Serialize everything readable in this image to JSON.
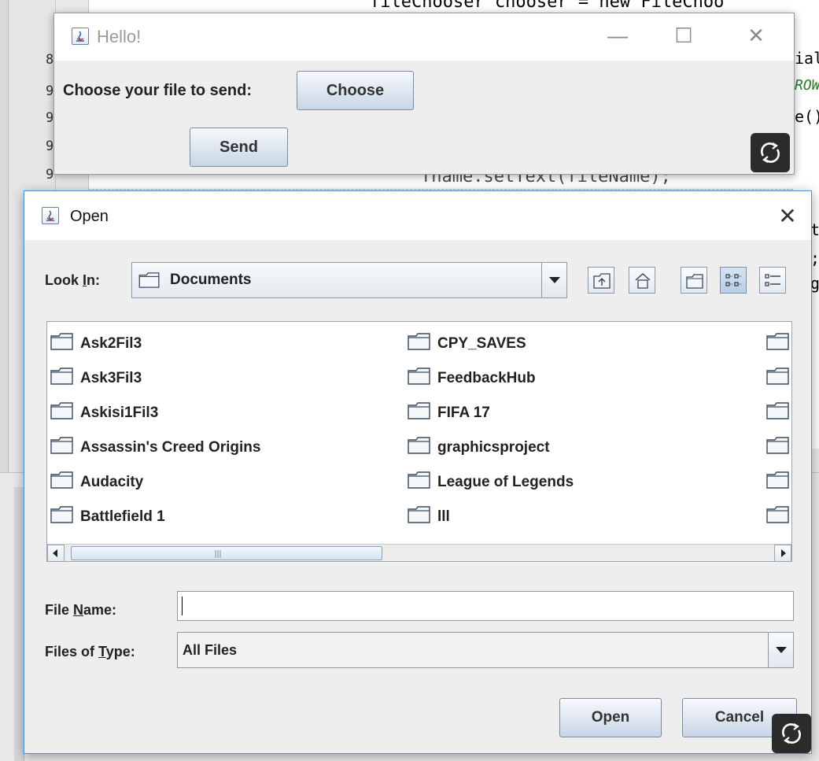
{
  "ide": {
    "line_numbers": [
      "8",
      "9",
      "9",
      "9",
      "9"
    ],
    "code_top": "fileChooser chooser = new FileChoo",
    "code_top_kw": "new",
    "code_right": [
      "ial",
      "ROW",
      "e()",
      "t",
      ";",
      "g"
    ],
    "code_bottom": "fname.setText(fileName);"
  },
  "hello_dialog": {
    "title": "Hello!",
    "minimize": "—",
    "maximize": "☐",
    "close": "✕",
    "choose_label": "Choose your file to send:",
    "choose_button": "Choose",
    "send_button": "Send",
    "refresh_icon": "refresh-icon"
  },
  "open_dialog": {
    "title": "Open",
    "close": "✕",
    "look_in_label_pre": "Look ",
    "look_in_label_mnemonic": "I",
    "look_in_label_post": "n:",
    "look_in_value": "Documents",
    "toolbar_icons": [
      "up-one-level-icon",
      "home-icon",
      "new-folder-icon",
      "list-view-icon",
      "details-view-icon"
    ],
    "files_col1": [
      "Ask2Fil3",
      "Ask3Fil3",
      "Askisi1Fil3",
      "Assassin's Creed Origins",
      "Audacity",
      "Battlefield 1"
    ],
    "files_col2": [
      "CPY_SAVES",
      "FeedbackHub",
      "FIFA 17",
      "graphicsproject",
      "League of Legends",
      "lll"
    ],
    "file_name_label_pre": "File ",
    "file_name_label_mnemonic": "N",
    "file_name_label_post": "ame:",
    "file_name_value": "",
    "files_of_type_label_pre": "Files of ",
    "files_of_type_label_mnemonic": "T",
    "files_of_type_label_post": "ype:",
    "files_of_type_value": "All Files",
    "open_button": "Open",
    "cancel_button": "Cancel"
  }
}
